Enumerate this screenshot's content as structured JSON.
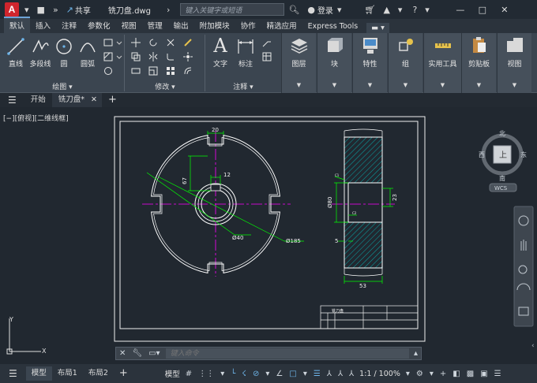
{
  "titlebar": {
    "share_label": "共享",
    "filename": "铣刀盘.dwg",
    "search_placeholder": "键入关键字或短语",
    "login_label": "登录"
  },
  "ribbon_tabs": [
    "默认",
    "插入",
    "注释",
    "参数化",
    "视图",
    "管理",
    "输出",
    "附加模块",
    "协作",
    "精选应用",
    "Express Tools"
  ],
  "ribbon": {
    "draw_group": {
      "label": "绘图 ▾",
      "buttons": [
        "直线",
        "多段线",
        "圆",
        "圆弧"
      ]
    },
    "modify_group": {
      "label": "修改 ▾"
    },
    "annotate_group": {
      "label": "注释 ▾",
      "buttons": [
        "文字",
        "标注"
      ]
    },
    "panels": [
      "图层",
      "块",
      "特性",
      "组",
      "实用工具",
      "剪贴板",
      "视图"
    ]
  },
  "file_tabs": {
    "start": "开始",
    "current": "铣刀盘*"
  },
  "view_label": "[−][俯视][二维线框]",
  "viewcube": {
    "north": "北",
    "south": "南",
    "east": "东",
    "west": "西",
    "top": "上",
    "wcs": "WCS"
  },
  "drawing": {
    "dim_slot_width": "20",
    "dim_67": "67",
    "dim_12": "12",
    "dim_d40": "Ø40",
    "dim_d185": "Ø185",
    "dim_d80": "Ø80",
    "dim_23": "23",
    "dim_5": "5",
    "dim_53": "53",
    "dim_c1_top": "C1",
    "dim_c2": "C2",
    "title_block_name": "铣刀盘"
  },
  "command": {
    "placeholder": "键入命令"
  },
  "status": {
    "layout_tabs": [
      "模型",
      "布局1",
      "布局2"
    ],
    "model_label": "模型",
    "scale": "1:1 / 100%"
  },
  "colors": {
    "background": "#212830",
    "dimension": "#00ff00",
    "hatch": "#00c8c8",
    "centerline": "#ff00ff",
    "geometry": "#ffffff",
    "accent": "#d0252d"
  }
}
